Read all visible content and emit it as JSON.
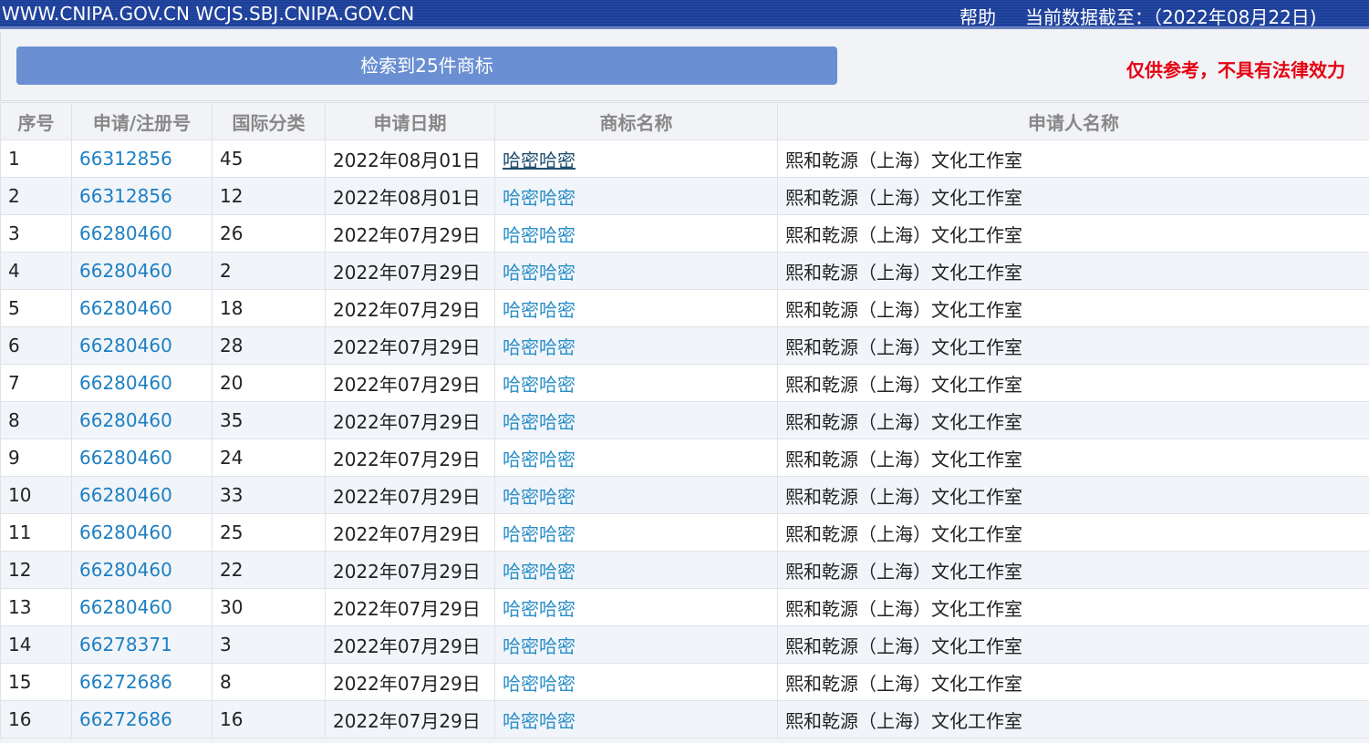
{
  "header": {
    "site_text": "WWW.CNIPA.GOV.CN WCJS.SBJ.CNIPA.GOV.CN",
    "help_label": "帮助",
    "cutoff_text": "当前数据截至：（2022年08月22日)"
  },
  "search": {
    "result_label": "检索到25件商标",
    "disclaimer": "仅供参考，不具有法律效力"
  },
  "table": {
    "headers": [
      "序号",
      "申请/注册号",
      "国际分类",
      "申请日期",
      "商标名称",
      "申请人名称"
    ],
    "rows": [
      {
        "no": "1",
        "reg": "66312856",
        "cls": "45",
        "date": "2022年08月01日",
        "name": "哈密哈密",
        "applicant": "熙和乾源（上海）文化工作室"
      },
      {
        "no": "2",
        "reg": "66312856",
        "cls": "12",
        "date": "2022年08月01日",
        "name": "哈密哈密",
        "applicant": "熙和乾源（上海）文化工作室"
      },
      {
        "no": "3",
        "reg": "66280460",
        "cls": "26",
        "date": "2022年07月29日",
        "name": "哈密哈密",
        "applicant": "熙和乾源（上海）文化工作室"
      },
      {
        "no": "4",
        "reg": "66280460",
        "cls": "2",
        "date": "2022年07月29日",
        "name": "哈密哈密",
        "applicant": "熙和乾源（上海）文化工作室"
      },
      {
        "no": "5",
        "reg": "66280460",
        "cls": "18",
        "date": "2022年07月29日",
        "name": "哈密哈密",
        "applicant": "熙和乾源（上海）文化工作室"
      },
      {
        "no": "6",
        "reg": "66280460",
        "cls": "28",
        "date": "2022年07月29日",
        "name": "哈密哈密",
        "applicant": "熙和乾源（上海）文化工作室"
      },
      {
        "no": "7",
        "reg": "66280460",
        "cls": "20",
        "date": "2022年07月29日",
        "name": "哈密哈密",
        "applicant": "熙和乾源（上海）文化工作室"
      },
      {
        "no": "8",
        "reg": "66280460",
        "cls": "35",
        "date": "2022年07月29日",
        "name": "哈密哈密",
        "applicant": "熙和乾源（上海）文化工作室"
      },
      {
        "no": "9",
        "reg": "66280460",
        "cls": "24",
        "date": "2022年07月29日",
        "name": "哈密哈密",
        "applicant": "熙和乾源（上海）文化工作室"
      },
      {
        "no": "10",
        "reg": "66280460",
        "cls": "33",
        "date": "2022年07月29日",
        "name": "哈密哈密",
        "applicant": "熙和乾源（上海）文化工作室"
      },
      {
        "no": "11",
        "reg": "66280460",
        "cls": "25",
        "date": "2022年07月29日",
        "name": "哈密哈密",
        "applicant": "熙和乾源（上海）文化工作室"
      },
      {
        "no": "12",
        "reg": "66280460",
        "cls": "22",
        "date": "2022年07月29日",
        "name": "哈密哈密",
        "applicant": "熙和乾源（上海）文化工作室"
      },
      {
        "no": "13",
        "reg": "66280460",
        "cls": "30",
        "date": "2022年07月29日",
        "name": "哈密哈密",
        "applicant": "熙和乾源（上海）文化工作室"
      },
      {
        "no": "14",
        "reg": "66278371",
        "cls": "3",
        "date": "2022年07月29日",
        "name": "哈密哈密",
        "applicant": "熙和乾源（上海）文化工作室"
      },
      {
        "no": "15",
        "reg": "66272686",
        "cls": "8",
        "date": "2022年07月29日",
        "name": "哈密哈密",
        "applicant": "熙和乾源（上海）文化工作室"
      },
      {
        "no": "16",
        "reg": "66272686",
        "cls": "16",
        "date": "2022年07月29日",
        "name": "哈密哈密",
        "applicant": "熙和乾源（上海）文化工作室"
      }
    ]
  },
  "colors": {
    "header_bg": "#1c3f9a",
    "result_button_bg": "#6a8fd2",
    "disclaimer": "#e60012",
    "link": "#1e7fc2"
  }
}
